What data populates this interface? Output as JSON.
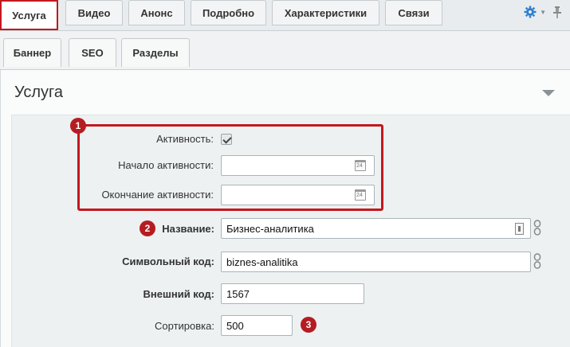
{
  "tabs": [
    {
      "label": "Услуга",
      "active": true
    },
    {
      "label": "Видео",
      "active": false
    },
    {
      "label": "Анонс",
      "active": false
    },
    {
      "label": "Подробно",
      "active": false
    },
    {
      "label": "Характеристики",
      "active": false
    },
    {
      "label": "Связи",
      "active": false
    }
  ],
  "subtabs": [
    {
      "label": "Баннер"
    },
    {
      "label": "SEO"
    },
    {
      "label": "Разделы"
    }
  ],
  "section": {
    "title": "Услуга"
  },
  "fields": {
    "active": {
      "label": "Активность:",
      "checked": true
    },
    "active_from": {
      "label": "Начало активности:",
      "value": ""
    },
    "active_to": {
      "label": "Окончание активности:",
      "value": ""
    },
    "name": {
      "label": "Название:",
      "value": "Бизнес-аналитика"
    },
    "code": {
      "label": "Символьный код:",
      "value": "biznes-analitika"
    },
    "external_code": {
      "label": "Внешний код:",
      "value": "1567"
    },
    "sort": {
      "label": "Сортировка:",
      "value": "500"
    }
  },
  "badges": [
    "1",
    "2",
    "3"
  ],
  "colors": {
    "accent_red": "#c2181e",
    "gear_blue": "#2b7fd0"
  },
  "icons": [
    "gear-icon",
    "pin-icon",
    "calendar-icon",
    "edit-icon",
    "link-icon",
    "checkmark-icon",
    "collapse-arrow-icon"
  ]
}
